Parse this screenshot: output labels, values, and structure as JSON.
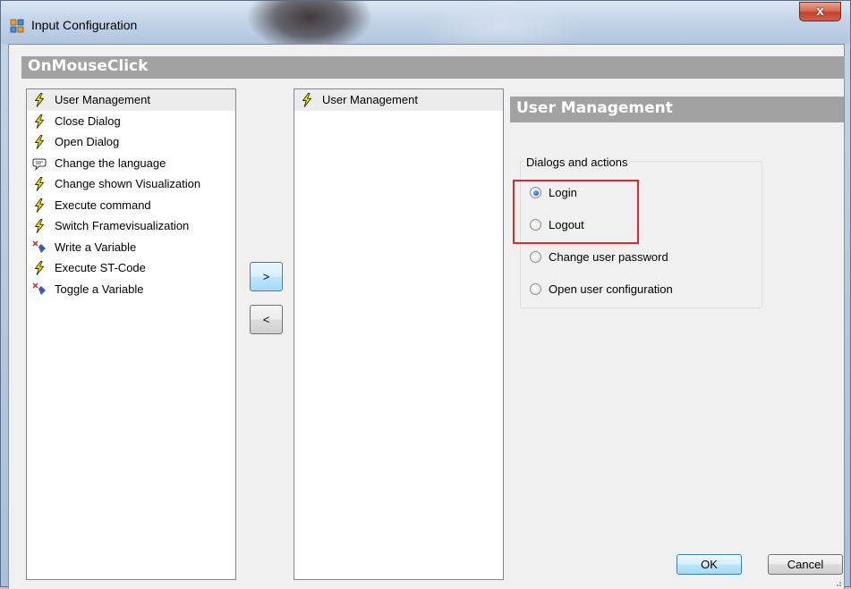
{
  "window": {
    "title": "Input Configuration",
    "close_glyph": "x"
  },
  "header": {
    "title": "OnMouseClick"
  },
  "available_actions": {
    "items": [
      {
        "label": "User Management",
        "icon": "lightning-icon",
        "selected": true
      },
      {
        "label": "Close Dialog",
        "icon": "lightning-icon",
        "selected": false
      },
      {
        "label": "Open Dialog",
        "icon": "lightning-icon",
        "selected": false
      },
      {
        "label": "Change the language",
        "icon": "speech-bubble-icon",
        "selected": false
      },
      {
        "label": "Change shown Visualization",
        "icon": "lightning-icon",
        "selected": false
      },
      {
        "label": "Execute command",
        "icon": "lightning-icon",
        "selected": false
      },
      {
        "label": "Switch Framevisualization",
        "icon": "lightning-icon",
        "selected": false
      },
      {
        "label": "Write a Variable",
        "icon": "write-variable-icon",
        "selected": false
      },
      {
        "label": "Execute ST-Code",
        "icon": "lightning-icon",
        "selected": false
      },
      {
        "label": "Toggle a Variable",
        "icon": "write-variable-icon",
        "selected": false
      }
    ]
  },
  "selected_actions": {
    "items": [
      {
        "label": "User Management",
        "icon": "lightning-icon",
        "selected": true
      }
    ]
  },
  "transfer": {
    "add_label": ">",
    "remove_label": "<"
  },
  "panel": {
    "title": "User Management",
    "group_label": "Dialogs and actions",
    "options": [
      {
        "label": "Login",
        "checked": true
      },
      {
        "label": "Logout",
        "checked": false
      },
      {
        "label": "Change user password",
        "checked": false
      },
      {
        "label": "Open user configuration",
        "checked": false
      }
    ]
  },
  "footer": {
    "ok_label": "OK",
    "cancel_label": "Cancel"
  },
  "colors": {
    "header_bar": "#a2a2a2",
    "highlight": "#e0272c",
    "lightning": "#f2e600"
  }
}
